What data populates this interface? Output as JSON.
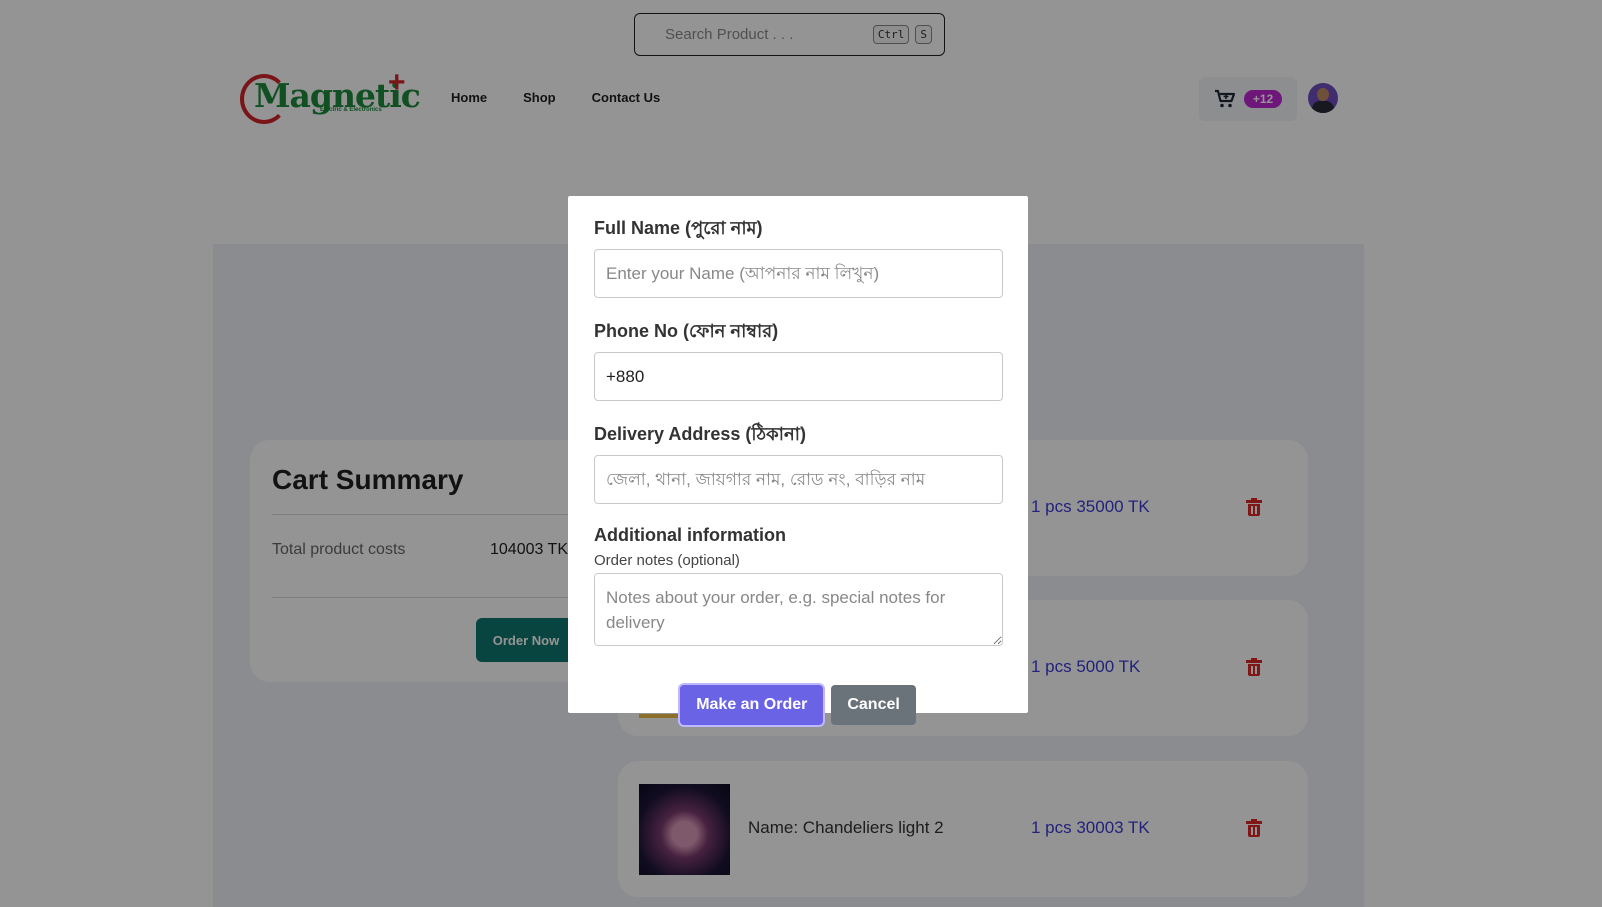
{
  "search": {
    "placeholder": "Search Product . . .",
    "shortcut_keys": [
      "Ctrl",
      "S"
    ]
  },
  "brand": {
    "logo_text": "Magnetic",
    "logo_plus": "+",
    "logo_tagline": "Electric & Electronics"
  },
  "nav": {
    "items": [
      {
        "label": "Home"
      },
      {
        "label": "Shop"
      },
      {
        "label": "Contact Us"
      }
    ]
  },
  "cart": {
    "icon": "cart-icon",
    "badge": "+12"
  },
  "summary": {
    "title": "Cart Summary",
    "total_label": "Total product costs",
    "total_value": "104003 TK",
    "order_button": "Order Now"
  },
  "items": [
    {
      "name": "",
      "qty_price": "1 pcs 35000 TK"
    },
    {
      "name": "",
      "qty_price": "1 pcs 5000 TK"
    },
    {
      "name": "Name: Chandeliers light 2",
      "qty_price": "1 pcs 30003 TK"
    }
  ],
  "modal": {
    "full_name_label": "Full Name (পুরো নাম)",
    "full_name_placeholder": "Enter your Name (আপনার নাম লিখুন)",
    "phone_label": "Phone No (ফোন নাম্বার)",
    "phone_value": "+880",
    "address_label": "Delivery Address (ঠিকানা)",
    "address_placeholder": "জেলা, থানা, জায়গার নাম, রোড নং, বাড়ির নাম",
    "additional_label": "Additional information",
    "notes_label": "Order notes (optional)",
    "notes_placeholder": "Notes about your order, e.g. special notes for delivery",
    "submit_button": "Make an Order",
    "cancel_button": "Cancel"
  },
  "colors": {
    "primary": "#6b63e6",
    "secondary": "#6b737a",
    "order_now": "#0f766e",
    "badge": "#c026d3",
    "price": "#3b3bd6",
    "delete": "#dc2626"
  }
}
